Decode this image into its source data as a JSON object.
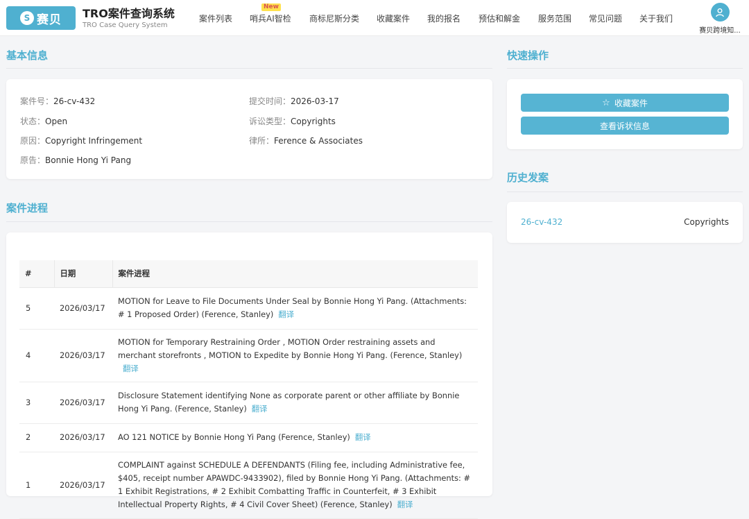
{
  "header": {
    "logo_text": "赛贝",
    "logo_mark": "S",
    "brand_title": "TRO案件查询系统",
    "brand_subtitle": "TRO Case Query System",
    "nav": [
      {
        "label": "案件列表"
      },
      {
        "label": "哨兵AI智检",
        "badge": "New"
      },
      {
        "label": "商标尼斯分类"
      },
      {
        "label": "收藏案件"
      },
      {
        "label": "我的报名"
      },
      {
        "label": "预估和解金"
      },
      {
        "label": "服务范围"
      },
      {
        "label": "常见问题"
      },
      {
        "label": "关于我们"
      }
    ],
    "user_name": "赛贝跨境知..."
  },
  "basic_info": {
    "title": "基本信息",
    "fields": {
      "case_no_label": "案件号：",
      "case_no": "26-cv-432",
      "submit_label": "提交时间：",
      "submit_time": "2026-03-17",
      "status_label": "状态：",
      "status": "Open",
      "suit_label": "诉讼类型：",
      "suit_type": "Copyrights",
      "cause_label": "原因：",
      "cause": "Copyright Infringement",
      "firm_label": "律所：",
      "firm": "Ference & Associates",
      "plaintiff_label": "原告：",
      "plaintiff": "Bonnie Hong Yi Pang"
    }
  },
  "quick_actions": {
    "title": "快速操作",
    "favorite_label": "收藏案件",
    "view_complaint_label": "查看诉状信息"
  },
  "history": {
    "title": "历史发案",
    "items": [
      {
        "case_no": "26-cv-432",
        "type": "Copyrights"
      }
    ]
  },
  "progress": {
    "title": "案件进程",
    "columns": {
      "no": "#",
      "date": "日期",
      "progress": "案件进程"
    },
    "translate_label": "翻译",
    "rows": [
      {
        "no": "5",
        "date": "2026/03/17",
        "text": "MOTION for Leave to File Documents Under Seal by Bonnie Hong Yi Pang. (Attachments: # 1 Proposed Order) (Ference, Stanley)"
      },
      {
        "no": "4",
        "date": "2026/03/17",
        "text": "MOTION for Temporary Restraining Order , MOTION Order restraining assets and merchant storefronts , MOTION to Expedite by Bonnie Hong Yi Pang. (Ference, Stanley)"
      },
      {
        "no": "3",
        "date": "2026/03/17",
        "text": "Disclosure Statement identifying None as corporate parent or other affiliate by Bonnie Hong Yi Pang. (Ference, Stanley)"
      },
      {
        "no": "2",
        "date": "2026/03/17",
        "text": "AO 121 NOTICE by Bonnie Hong Yi Pang (Ference, Stanley)"
      },
      {
        "no": "1",
        "date": "2026/03/17",
        "text": "COMPLAINT against SCHEDULE A DEFENDANTS (Filing fee, including Administrative fee, $405, receipt number APAWDC-9433902), filed by Bonnie Hong Yi Pang. (Attachments: # 1 Exhibit Registrations, # 2 Exhibit Combatting Traffic in Counterfeit, # 3 Exhibit Intellectual Property Rights, # 4 Civil Cover Sheet) (Ference, Stanley)"
      }
    ]
  },
  "colors": {
    "accent": "#4fb0d0",
    "button": "#56b4d3",
    "badge_bg": "#ffe14d",
    "badge_text": "#d9534f"
  },
  "icons": {
    "favorite": "star-icon",
    "user": "user-icon"
  }
}
